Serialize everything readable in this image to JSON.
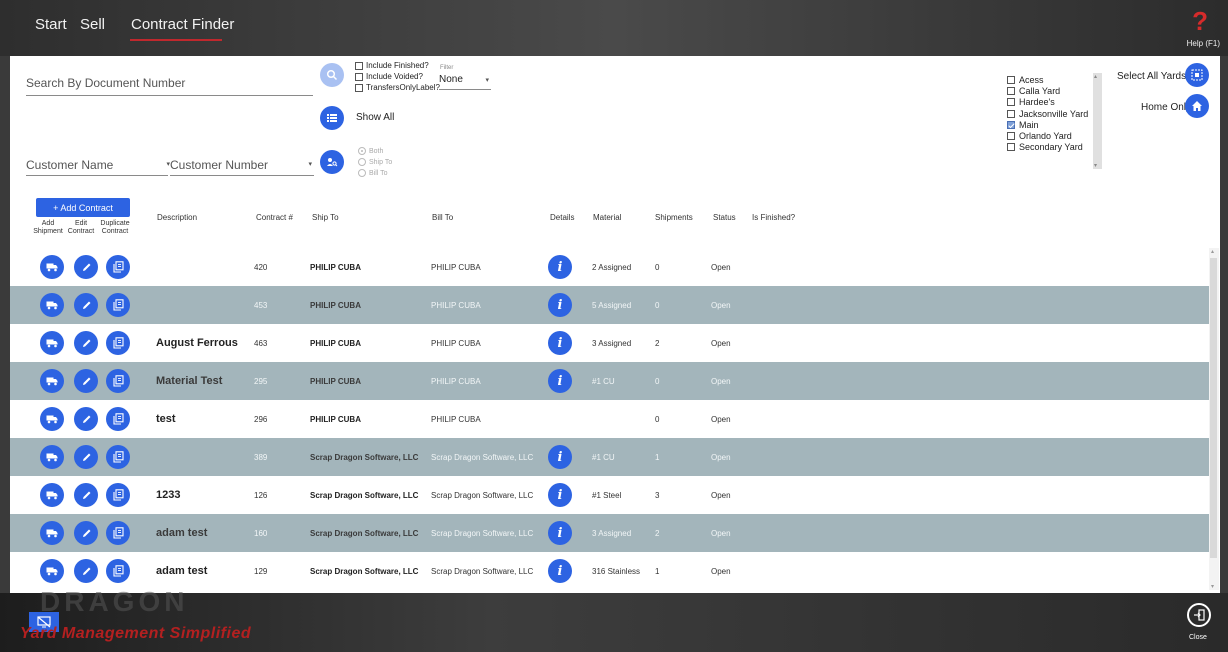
{
  "nav": {
    "start": "Start",
    "sell": "Sell",
    "contract_finder": "Contract Finder",
    "help_label": "Help (F1)",
    "help_glyph": "?"
  },
  "search": {
    "document_placeholder": "Search By Document Number",
    "include_finished": "Include Finished?",
    "include_voided": "Include Voided?",
    "transfers_only": "TransfersOnlyLabel?",
    "filter_label": "Filter",
    "filter_value": "None",
    "show_all": "Show All",
    "customer_name_placeholder": "Customer Name",
    "customer_number_placeholder": "Customer Number",
    "radio_both": "Both",
    "radio_ship_to": "Ship To",
    "radio_bill_to": "Bill To"
  },
  "yards": {
    "items": [
      {
        "label": "Acess",
        "checked": false
      },
      {
        "label": "Calla Yard",
        "checked": false
      },
      {
        "label": "Hardee's",
        "checked": false
      },
      {
        "label": "Jacksonville Yard",
        "checked": false
      },
      {
        "label": "Main",
        "checked": true
      },
      {
        "label": "Orlando Yard",
        "checked": false
      },
      {
        "label": "Secondary Yard",
        "checked": false
      }
    ],
    "select_all_label": "Select All Yards",
    "home_only_label": "Home Only"
  },
  "table": {
    "add_contract_label": "+ Add Contract",
    "sub_headers": {
      "add_shipment": "Add Shipment",
      "edit_contract": "Edit Contract",
      "duplicate_contract": "Duplicate Contract"
    },
    "headers": {
      "description": "Description",
      "contract": "Contract #",
      "ship_to": "Ship To",
      "bill_to": "Bill To",
      "details": "Details",
      "material": "Material",
      "shipments": "Shipments",
      "status": "Status",
      "is_finished": "Is Finished?"
    },
    "rows": [
      {
        "description": "",
        "contract": "420",
        "ship_to": "PHILIP CUBA",
        "bill_to": "PHILIP CUBA",
        "details": true,
        "material": "2 Assigned",
        "shipments": "0",
        "status": "Open"
      },
      {
        "description": "",
        "contract": "453",
        "ship_to": "PHILIP CUBA",
        "bill_to": "PHILIP CUBA",
        "details": true,
        "material": "5 Assigned",
        "shipments": "0",
        "status": "Open"
      },
      {
        "description": "August Ferrous",
        "contract": "463",
        "ship_to": "PHILIP CUBA",
        "bill_to": "PHILIP CUBA",
        "details": true,
        "material": "3 Assigned",
        "shipments": "2",
        "status": "Open"
      },
      {
        "description": "Material Test",
        "contract": "295",
        "ship_to": "PHILIP CUBA",
        "bill_to": "PHILIP CUBA",
        "details": true,
        "material": "#1 CU",
        "shipments": "0",
        "status": "Open"
      },
      {
        "description": "test",
        "contract": "296",
        "ship_to": "PHILIP CUBA",
        "bill_to": "PHILIP CUBA",
        "details": false,
        "material": "",
        "shipments": "0",
        "status": "Open"
      },
      {
        "description": "",
        "contract": "389",
        "ship_to": "Scrap Dragon Software, LLC",
        "bill_to": "Scrap Dragon Software, LLC",
        "details": true,
        "material": "#1 CU",
        "shipments": "1",
        "status": "Open"
      },
      {
        "description": "1233",
        "contract": "126",
        "ship_to": "Scrap Dragon Software, LLC",
        "bill_to": "Scrap Dragon Software, LLC",
        "details": true,
        "material": "#1 Steel",
        "shipments": "3",
        "status": "Open"
      },
      {
        "description": "adam test",
        "contract": "160",
        "ship_to": "Scrap Dragon Software, LLC",
        "bill_to": "Scrap Dragon Software, LLC",
        "details": true,
        "material": "3 Assigned",
        "shipments": "2",
        "status": "Open"
      },
      {
        "description": "adam test",
        "contract": "129",
        "ship_to": "Scrap Dragon Software, LLC",
        "bill_to": "Scrap Dragon Software, LLC",
        "details": true,
        "material": "316 Stainless",
        "shipments": "1",
        "status": "Open"
      }
    ]
  },
  "footer": {
    "brand_tagline": "Yard Management Simplified",
    "brand_name": "DRAGON",
    "close_label": "Close"
  },
  "colors": {
    "accent": "#2d63e2",
    "row_alt": "#a3b5bb",
    "brand_red": "#b32020"
  }
}
